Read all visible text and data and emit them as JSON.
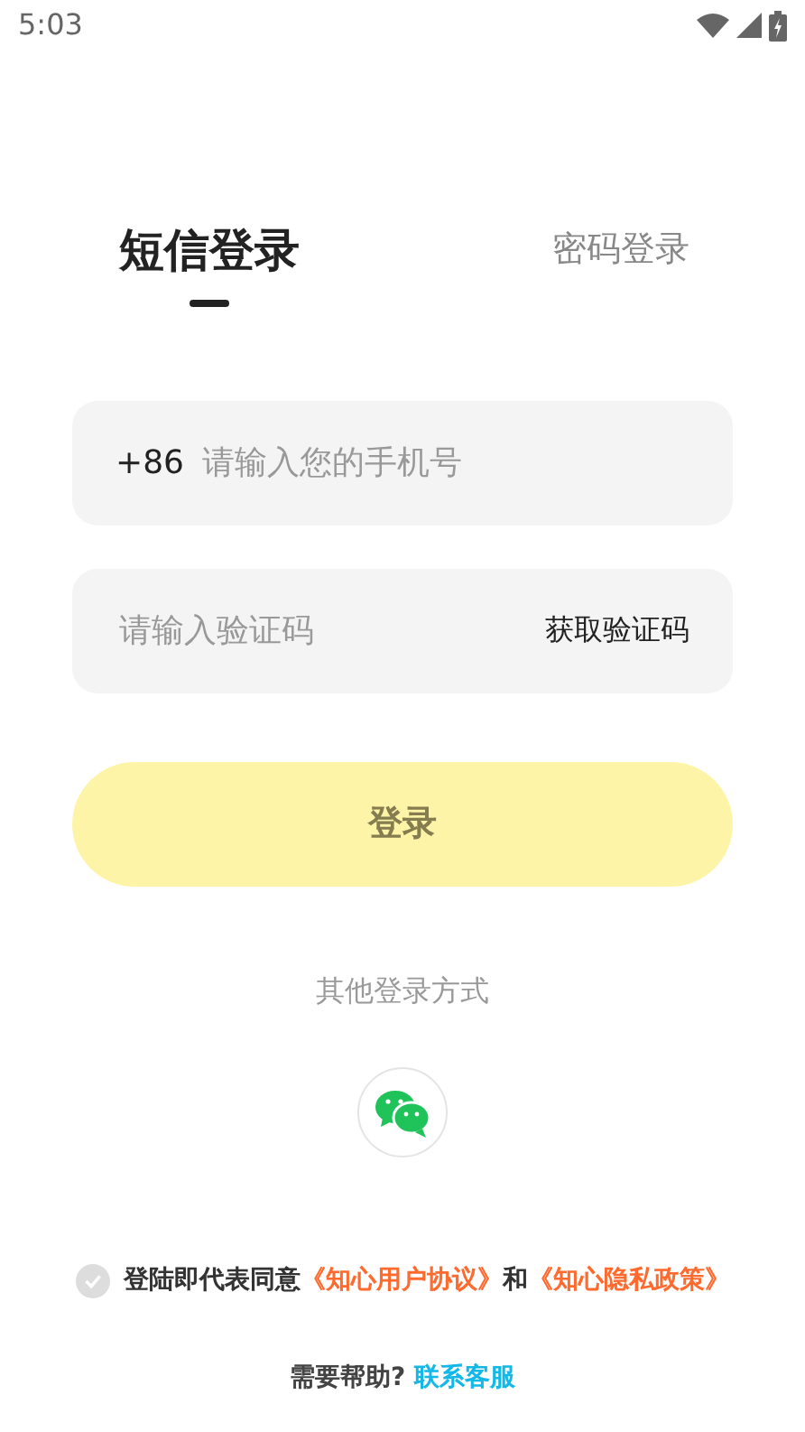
{
  "status_bar": {
    "time": "5:03"
  },
  "tabs": [
    {
      "label": "短信登录",
      "selected": true
    },
    {
      "label": "密码登录",
      "selected": false
    }
  ],
  "phone_field": {
    "prefix": "+86",
    "placeholder": "请输入您的手机号"
  },
  "code_field": {
    "placeholder": "请输入验证码",
    "action": "获取验证码"
  },
  "login_button": {
    "label": "登录",
    "disabled": true
  },
  "other_login": {
    "title": "其他登录方式"
  },
  "agreement": {
    "checked": false,
    "text": "登陆即代表同意",
    "link_1": "《知心用户协议》",
    "joiner": "和",
    "link_2": "《知心隐私政策》"
  },
  "help": {
    "text": "需要帮助?",
    "link": "联系客服"
  }
}
